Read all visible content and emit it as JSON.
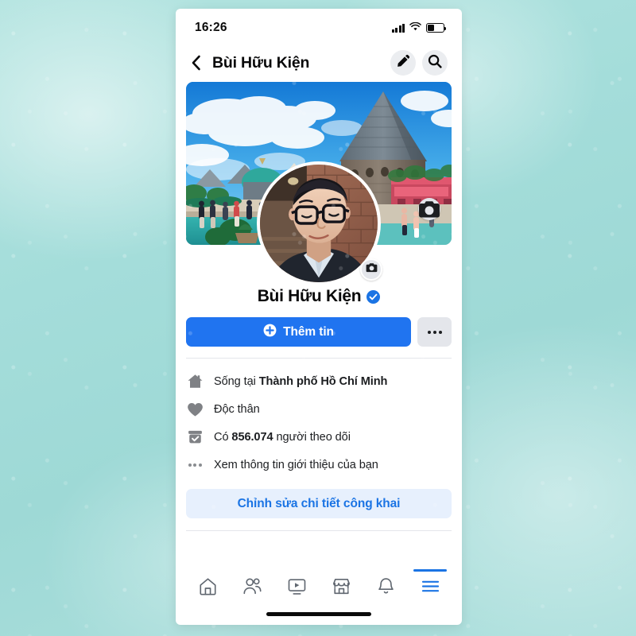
{
  "status_bar": {
    "time": "16:26",
    "signal_icon": "cellular-signal-icon",
    "wifi_icon": "wifi-icon",
    "battery_icon": "battery-icon",
    "battery_level_percent": 42
  },
  "header": {
    "back_icon": "back-chevron-icon",
    "title": "Bùi Hữu Kiện",
    "edit_icon": "pencil-icon",
    "search_icon": "search-icon"
  },
  "cover": {
    "cover_photo_alt": "Ảnh bìa khu du lịch có tháp đá nón nhọn và bầu trời xanh",
    "cover_camera_icon": "camera-icon",
    "avatar_alt": "Ảnh đại diện nam đeo kính",
    "avatar_camera_icon": "camera-icon"
  },
  "profile": {
    "name": "Bùi Hữu Kiện",
    "verified_icon": "verified-badge-icon",
    "verified": true
  },
  "actions": {
    "primary_label": "Thêm tin",
    "primary_icon": "plus-circle-icon",
    "primary_color": "#2074F0",
    "more_icon": "more-horizontal-icon"
  },
  "info_rows": [
    {
      "icon": "home-icon",
      "prefix": "Sống tại ",
      "value": "Thành phố Hồ Chí Minh",
      "suffix": ""
    },
    {
      "icon": "heart-icon",
      "prefix": "Độc thân",
      "value": "",
      "suffix": ""
    },
    {
      "icon": "followers-check-icon",
      "prefix": "Có ",
      "value": "856.074",
      "suffix": " người theo dõi"
    },
    {
      "icon": "more-dots-icon",
      "prefix": "Xem thông tin giới thiệu của bạn",
      "value": "",
      "suffix": ""
    }
  ],
  "edit_public": {
    "label": "Chỉnh sửa chi tiết công khai",
    "text_color": "#1B74E4",
    "bg_color": "#E7F0FD"
  },
  "bottom_nav": {
    "active_color": "#1B74E4",
    "items": [
      {
        "icon": "home-outline-icon",
        "name": "home",
        "active": false
      },
      {
        "icon": "friends-icon",
        "name": "friends",
        "active": false
      },
      {
        "icon": "video-icon",
        "name": "video",
        "active": false
      },
      {
        "icon": "marketplace-icon",
        "name": "marketplace",
        "active": false
      },
      {
        "icon": "bell-icon",
        "name": "notifications",
        "active": false
      },
      {
        "icon": "hamburger-menu-icon",
        "name": "menu",
        "active": true
      }
    ]
  },
  "background": {
    "color": "#a4ddda"
  }
}
